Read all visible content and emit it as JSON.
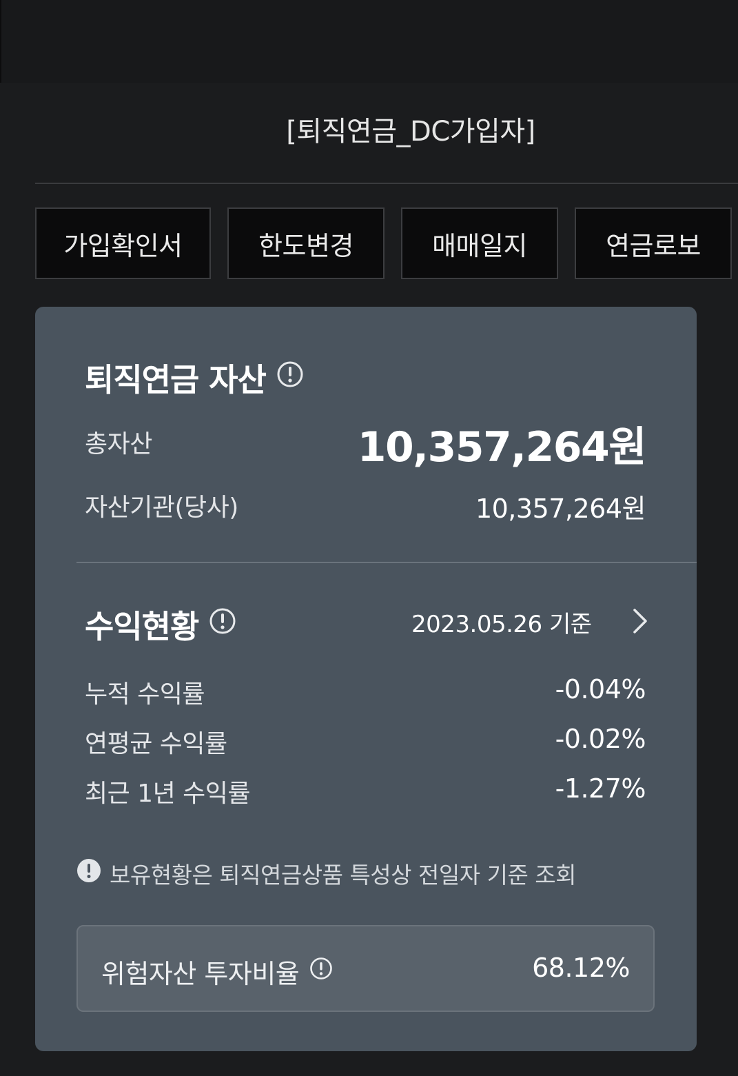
{
  "header": {
    "title": "[퇴직연금_DC가입자]"
  },
  "tabs": [
    {
      "label": "가입확인서"
    },
    {
      "label": "한도변경"
    },
    {
      "label": "매매일지"
    },
    {
      "label": "연금로보"
    }
  ],
  "assets": {
    "title": "퇴직연금 자산",
    "total_label": "총자산",
    "total_value": "10,357,264원",
    "institution_label": "자산기관(당사)",
    "institution_value": "10,357,264원"
  },
  "returns": {
    "title": "수익현황",
    "date": "2023.05.26 기준",
    "rows": [
      {
        "label": "누적 수익률",
        "value": "-0.04%"
      },
      {
        "label": "연평균 수익률",
        "value": "-0.02%"
      },
      {
        "label": "최근 1년 수익률",
        "value": "-1.27%"
      }
    ]
  },
  "notice": {
    "text": "보유현황은 퇴직연금상품 특성상 전일자 기준 조회"
  },
  "risk": {
    "label": "위험자산 투자비율",
    "value": "68.12%"
  },
  "icons": {
    "info": "info-circle-icon",
    "chevron": "chevron-right-icon",
    "notice": "exclamation-filled-icon"
  },
  "colors": {
    "background": "#1b1c1e",
    "card": "#4a545e",
    "risk_box": "#59626b",
    "tab_bg": "#0b0b0c"
  }
}
